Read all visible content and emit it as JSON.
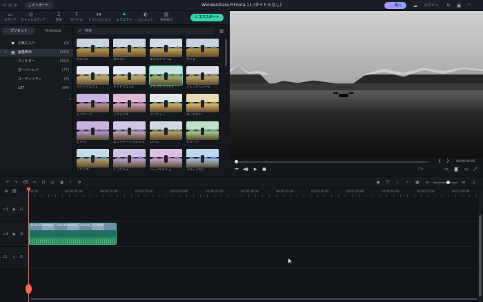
{
  "titlebar": {
    "import_label": "インポート",
    "app_title": "Wondershare Filmora 11 (タイトルなし)",
    "buy_label": "購入",
    "login_label": "ログイン"
  },
  "tabs": [
    {
      "label": "メディア",
      "icon": "folder-icon"
    },
    {
      "label": "ストックメディア",
      "icon": "stock-icon"
    },
    {
      "label": "音楽",
      "icon": "music-icon"
    },
    {
      "label": "タイトル",
      "icon": "title-icon"
    },
    {
      "label": "トランジション",
      "icon": "transition-icon"
    },
    {
      "label": "エフェクト",
      "icon": "effects-icon"
    },
    {
      "label": "エレメント",
      "icon": "element-icon"
    },
    {
      "label": "分割表示",
      "icon": "split-screen-icon"
    }
  ],
  "export_label": "エクスポート",
  "sidebar": {
    "tabs": [
      "プリセット",
      "Filmstock"
    ],
    "items": [
      {
        "label": "お気に入り",
        "count": "(0)",
        "icon": "heart-icon",
        "arrow": ""
      },
      {
        "label": "画像表示",
        "count": "(349)",
        "icon": "grid-icon",
        "arrow": "▾"
      },
      {
        "label": "フィルター",
        "count": "(150)",
        "icon": "",
        "arrow": "›"
      },
      {
        "label": "オーバーレイ",
        "count": "(77)",
        "icon": "",
        "arrow": "›"
      },
      {
        "label": "ユーティリティ",
        "count": "(4)",
        "icon": "",
        "arrow": ""
      },
      {
        "label": "LUT",
        "count": "(84)",
        "icon": "",
        "arrow": "›"
      }
    ]
  },
  "search": {
    "placeholder": "検索"
  },
  "effects": [
    {
      "label": "カメラ1"
    },
    {
      "label": "カメラ2"
    },
    {
      "label": "エクステリーム"
    },
    {
      "label": "サイレ"
    },
    {
      "label": "マイドウェイ1"
    },
    {
      "label": "マイドウェイ2"
    },
    {
      "label": "アップグリント1"
    },
    {
      "label": "アップグリント2"
    },
    {
      "label": "ビンテージ"
    },
    {
      "label": "ブラッシュ"
    },
    {
      "label": "ラブディー"
    },
    {
      "label": "ゴールデン"
    },
    {
      "label": "ビチラ"
    },
    {
      "label": "エプリシートスタイル"
    },
    {
      "label": "ローズ"
    },
    {
      "label": "グリーン"
    },
    {
      "label": "アリゾナ"
    },
    {
      "label": "イブラルズ"
    },
    {
      "label": "ハーブルヘイズ"
    },
    {
      "label": "ブルースカイ"
    }
  ],
  "preview": {
    "timecode": "00:00:00:00",
    "quality": "フル",
    "progress": 0.0
  },
  "ruler": [
    "00:00",
    "00:00:05:00",
    "00:00:10:00",
    "00:00:15:00",
    "00:00:20:00",
    "00:00:25:00",
    "00:00:30:00",
    "00:00:35:00",
    "00:00:40:00",
    "00:00:45:00",
    "00:00:50:00",
    "00:00:55:00",
    "00:01:00:00",
    "00:01:05:00"
  ],
  "tracks": [
    {
      "label": "1",
      "kind": "overlay"
    },
    {
      "label": "1",
      "kind": "video"
    },
    {
      "label": "1",
      "kind": "audio"
    }
  ],
  "clip": {
    "label": "Drone footage - Wondershare_Filmora_11.mp4"
  },
  "zoom": 0.6
}
